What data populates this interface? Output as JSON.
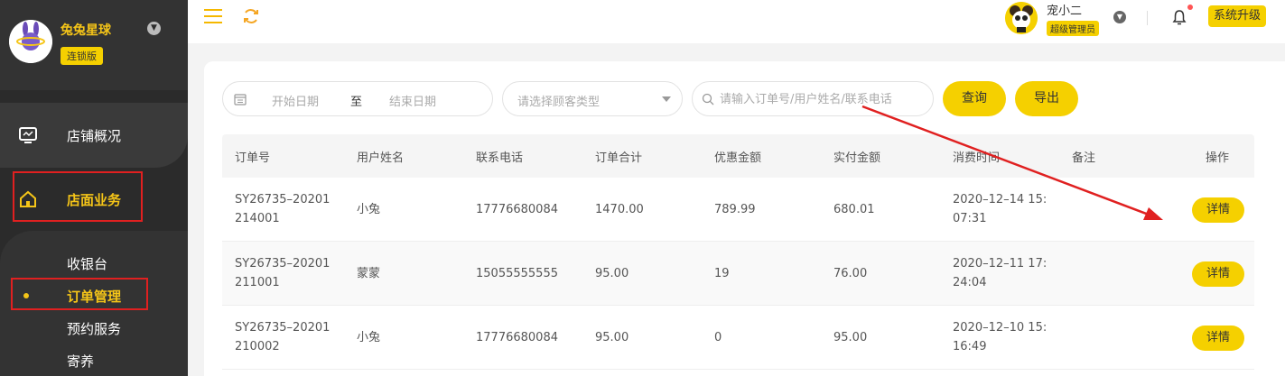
{
  "sidebar": {
    "brand_name": "兔兔星球",
    "brand_badge": "连锁版",
    "logo_text": "兔兔星球",
    "items": [
      {
        "label": "店铺概况",
        "icon": "monitor-icon"
      },
      {
        "label": "店面业务",
        "icon": "home-icon"
      }
    ],
    "subitems": [
      {
        "label": "收银台"
      },
      {
        "label": "订单管理",
        "active": true
      },
      {
        "label": "预约服务"
      },
      {
        "label": "寄养"
      }
    ]
  },
  "topbar": {
    "user_name": "宠小二",
    "user_role": "超级管理员",
    "upgrade_label": "系统升级"
  },
  "filters": {
    "date_start_placeholder": "开始日期",
    "date_separator": "至",
    "date_end_placeholder": "结束日期",
    "customer_type_placeholder": "请选择顾客类型",
    "search_placeholder": "请输入订单号/用户姓名/联系电话",
    "query_label": "查询",
    "export_label": "导出"
  },
  "table": {
    "columns": [
      "订单号",
      "用户姓名",
      "联系电话",
      "订单合计",
      "优惠金额",
      "实付金额",
      "消费时间",
      "备注",
      "操作"
    ],
    "detail_label": "详情",
    "rows": [
      {
        "order_no_1": "SY26735–20201",
        "order_no_2": "214001",
        "name": "小兔",
        "phone": "17776680084",
        "total": "1470.00",
        "discount": "789.99",
        "paid": "680.01",
        "time_1": "2020–12–14 15:",
        "time_2": "07:31",
        "note": ""
      },
      {
        "order_no_1": "SY26735–20201",
        "order_no_2": "211001",
        "name": "蒙蒙",
        "phone": "15055555555",
        "total": "95.00",
        "discount": "19",
        "paid": "76.00",
        "time_1": "2020–12–11 17:",
        "time_2": "24:04",
        "note": ""
      },
      {
        "order_no_1": "SY26735–20201",
        "order_no_2": "210002",
        "name": "小兔",
        "phone": "17776680084",
        "total": "95.00",
        "discount": "0",
        "paid": "95.00",
        "time_1": "2020–12–10 15:",
        "time_2": "16:49",
        "note": ""
      }
    ]
  },
  "colors": {
    "accent": "#f5d000",
    "sidebar_bg": "#2b2b2b",
    "annotation_red": "#e02020"
  }
}
